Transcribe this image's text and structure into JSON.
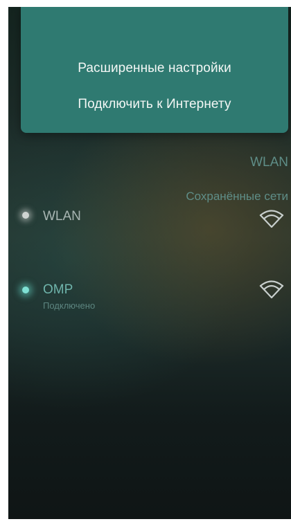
{
  "menu": {
    "items": [
      {
        "label": "Расширенные настройки"
      },
      {
        "label": "Подключить к Интернету"
      }
    ]
  },
  "wlan_section": {
    "header": "WLAN",
    "toggle_row": {
      "label": "WLAN",
      "icon": "wifi-icon"
    }
  },
  "saved_section": {
    "header": "Сохранённые сети",
    "networks": [
      {
        "name": "OMP",
        "status": "Подключено",
        "icon": "wifi-icon"
      }
    ]
  },
  "colors": {
    "popup_bg": "#2f7a71",
    "accent_teal": "#7fe0d4",
    "header_text": "#5f8e88"
  }
}
